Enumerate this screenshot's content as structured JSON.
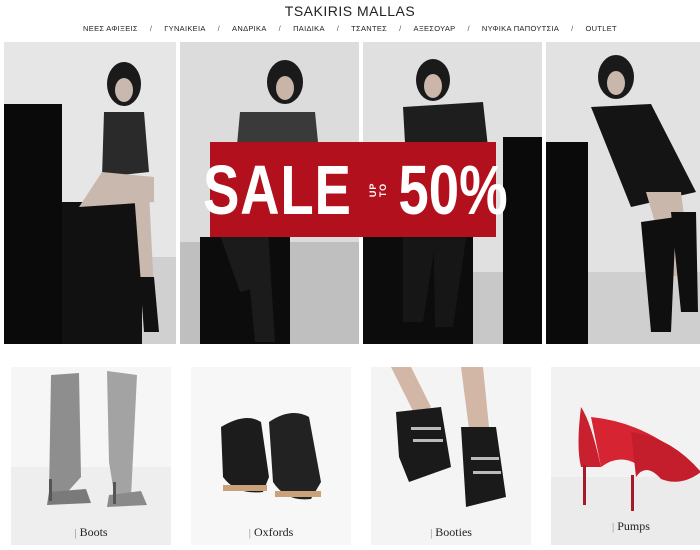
{
  "header": {
    "brand": "TSAKIRIS MALLAS"
  },
  "nav": {
    "items": [
      "ΝΕΕΣ ΑΦΙΞΕΙΣ",
      "ΓΥΝΑΙΚΕΙΑ",
      "ΑΝΔΡΙΚΑ",
      "ΠΑΙΔΙΚΑ",
      "ΤΣΑΝΤΕΣ",
      "ΑΞΕΣΟΥΑΡ",
      "ΝΥΦΙΚΑ ΠΑΠΟΥΤΣΙΑ",
      "OUTLET"
    ],
    "separator": "/"
  },
  "banner": {
    "sale_word": "SALE",
    "up_to": "UP TO",
    "percent": "50%",
    "color": "#b3101d"
  },
  "categories": [
    {
      "label": "Boots"
    },
    {
      "label": "Oxfords"
    },
    {
      "label": "Booties"
    },
    {
      "label": "Pumps"
    }
  ],
  "label_bar": "|"
}
